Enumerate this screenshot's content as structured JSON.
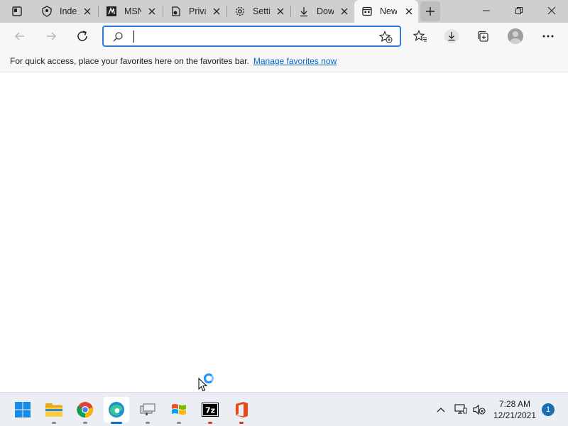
{
  "browser": {
    "tabs": [
      {
        "title": "Inde",
        "icon": "shield-user-icon"
      },
      {
        "title": "MSN",
        "icon": "msn-icon"
      },
      {
        "title": "Priva",
        "icon": "privacy-icon"
      },
      {
        "title": "Setti",
        "icon": "gear-icon"
      },
      {
        "title": "Dow",
        "icon": "download-icon"
      },
      {
        "title": "New",
        "icon": "new-tab-icon",
        "active": true
      }
    ],
    "address_value": "",
    "favorites_bar": {
      "message": "For quick access, place your favorites here on the favorites bar.",
      "link": "Manage favorites now"
    }
  },
  "taskbar": {
    "apps": [
      {
        "name": "windows-start",
        "running": false
      },
      {
        "name": "file-explorer",
        "running": true
      },
      {
        "name": "chrome",
        "running": true
      },
      {
        "name": "edge",
        "running": true,
        "active": true
      },
      {
        "name": "network-app",
        "running": true
      },
      {
        "name": "windows-xp-app",
        "running": true
      },
      {
        "name": "7zip",
        "running": true
      },
      {
        "name": "office",
        "running": true
      }
    ],
    "clock": {
      "time": "7:28 AM",
      "date": "12/21/2021"
    },
    "notification_count": "1"
  },
  "colors": {
    "accent": "#2b7fd9",
    "link": "#0b63c4",
    "tabstrip": "#cfcfcf",
    "taskbar": "#ebeef2"
  }
}
